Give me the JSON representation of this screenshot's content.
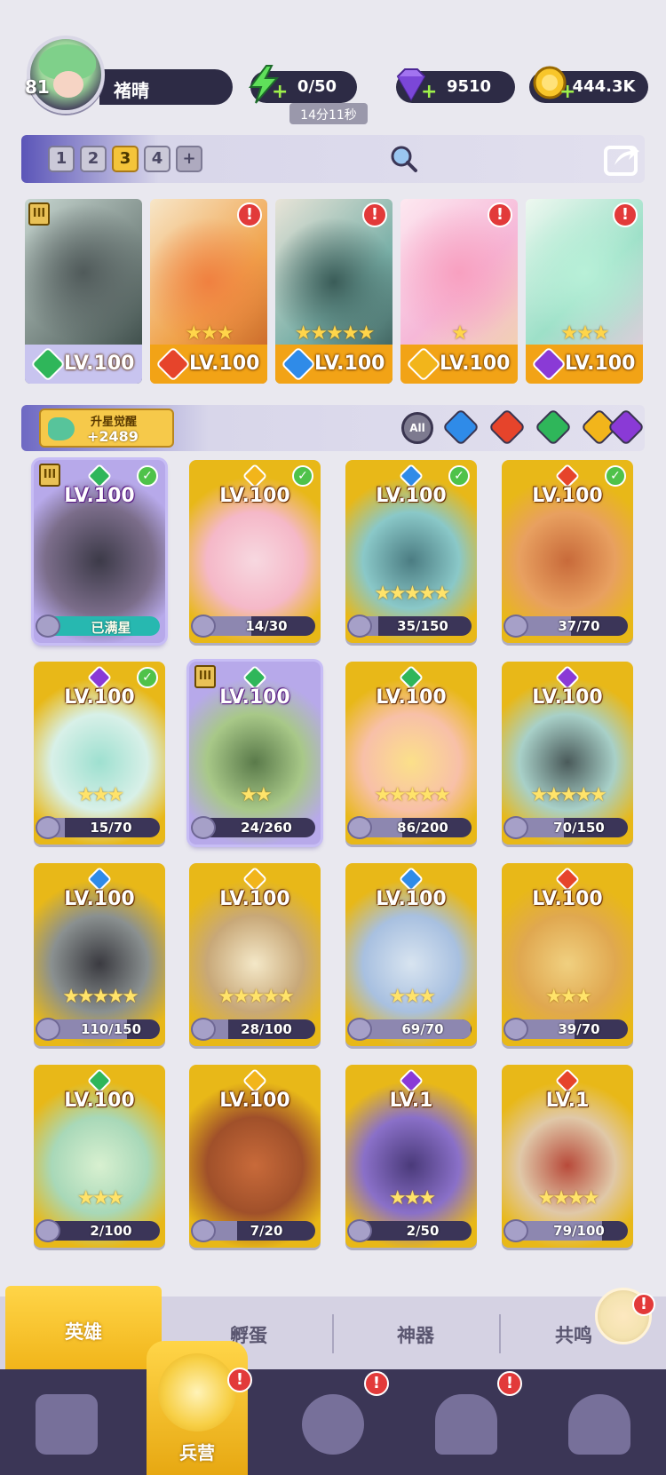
{
  "player": {
    "level": "81",
    "name": "褚晴"
  },
  "resources": {
    "energy": "0/50",
    "energy_timer": "14分11秒",
    "gems": "9510",
    "gold": "444.3K"
  },
  "team_tabs": [
    "1",
    "2",
    "3",
    "4",
    "+"
  ],
  "active_team_tab": 2,
  "team_slots": [
    {
      "lv": "LV.100",
      "element": "nature",
      "color": "#2fb65a",
      "stars": "",
      "alert": false
    },
    {
      "lv": "LV.100",
      "element": "fire",
      "color": "#e6442b",
      "stars": "★★★",
      "alert": true
    },
    {
      "lv": "LV.100",
      "element": "water",
      "color": "#2f8be8",
      "stars": "★★★★★",
      "alert": true
    },
    {
      "lv": "LV.100",
      "element": "light",
      "color": "#f2b51b",
      "stars": "★",
      "alert": true
    },
    {
      "lv": "LV.100",
      "element": "dark",
      "color": "#8a3ad6",
      "stars": "★★★",
      "alert": true
    }
  ],
  "awaken": {
    "label": "升星觉醒",
    "value": "+2489"
  },
  "filters": {
    "all": "All"
  },
  "heroes": [
    {
      "lv": "LV.100",
      "element_color": "#2fb65a",
      "progress": "已满星",
      "maxed": true,
      "fill": 1.0,
      "check": true,
      "rank": true,
      "purple": true,
      "stars": ""
    },
    {
      "lv": "LV.100",
      "element_color": "#f2b51b",
      "progress": "14/30",
      "maxed": false,
      "fill": 0.47,
      "check": true,
      "rank": false,
      "purple": false,
      "stars": ""
    },
    {
      "lv": "LV.100",
      "element_color": "#2f8be8",
      "progress": "35/150",
      "maxed": false,
      "fill": 0.23,
      "check": true,
      "rank": false,
      "purple": false,
      "stars": "★★★★★"
    },
    {
      "lv": "LV.100",
      "element_color": "#e6442b",
      "progress": "37/70",
      "maxed": false,
      "fill": 0.53,
      "check": true,
      "rank": false,
      "purple": false,
      "stars": ""
    },
    {
      "lv": "LV.100",
      "element_color": "#8a3ad6",
      "progress": "15/70",
      "maxed": false,
      "fill": 0.21,
      "check": true,
      "rank": false,
      "purple": false,
      "stars": "★★★"
    },
    {
      "lv": "LV.100",
      "element_color": "#2fb65a",
      "progress": "24/260",
      "maxed": false,
      "fill": 0.09,
      "check": false,
      "rank": true,
      "purple": true,
      "stars": "★★"
    },
    {
      "lv": "LV.100",
      "element_color": "#2fb65a",
      "progress": "86/200",
      "maxed": false,
      "fill": 0.43,
      "check": false,
      "rank": false,
      "purple": false,
      "stars": "★★★★★"
    },
    {
      "lv": "LV.100",
      "element_color": "#8a3ad6",
      "progress": "70/150",
      "maxed": false,
      "fill": 0.47,
      "check": false,
      "rank": false,
      "purple": false,
      "stars": "★★★★★"
    },
    {
      "lv": "LV.100",
      "element_color": "#2f8be8",
      "progress": "110/150",
      "maxed": false,
      "fill": 0.73,
      "check": false,
      "rank": false,
      "purple": false,
      "stars": "★★★★★"
    },
    {
      "lv": "LV.100",
      "element_color": "#f2b51b",
      "progress": "28/100",
      "maxed": false,
      "fill": 0.28,
      "check": false,
      "rank": false,
      "purple": false,
      "stars": "★★★★★"
    },
    {
      "lv": "LV.100",
      "element_color": "#2f8be8",
      "progress": "69/70",
      "maxed": false,
      "fill": 0.99,
      "check": false,
      "rank": false,
      "purple": false,
      "stars": "★★★"
    },
    {
      "lv": "LV.100",
      "element_color": "#e6442b",
      "progress": "39/70",
      "maxed": false,
      "fill": 0.56,
      "check": false,
      "rank": false,
      "purple": false,
      "stars": "★★★"
    },
    {
      "lv": "LV.100",
      "element_color": "#2fb65a",
      "progress": "2/100",
      "maxed": false,
      "fill": 0.02,
      "check": false,
      "rank": false,
      "purple": false,
      "stars": "★★★"
    },
    {
      "lv": "LV.100",
      "element_color": "#f2b51b",
      "progress": "7/20",
      "maxed": false,
      "fill": 0.35,
      "check": false,
      "rank": false,
      "purple": false,
      "stars": ""
    },
    {
      "lv": "LV.1",
      "element_color": "#8a3ad6",
      "progress": "2/50",
      "maxed": false,
      "fill": 0.04,
      "check": false,
      "rank": false,
      "purple": false,
      "stars": "★★★"
    },
    {
      "lv": "LV.1",
      "element_color": "#e6442b",
      "progress": "79/100",
      "maxed": false,
      "fill": 0.79,
      "check": false,
      "rank": false,
      "purple": false,
      "stars": "★★★★"
    }
  ],
  "bottom_tabs": [
    "英雄",
    "孵蛋",
    "神器",
    "共鸣"
  ],
  "nav": {
    "active_label": "兵营"
  },
  "colors": {
    "accent": "#f4c43a",
    "panel_dark": "#2d2b45",
    "nature": "#2fb65a",
    "water": "#2f8be8",
    "fire": "#e6442b",
    "light": "#f2b51b",
    "dark": "#8a3ad6"
  }
}
